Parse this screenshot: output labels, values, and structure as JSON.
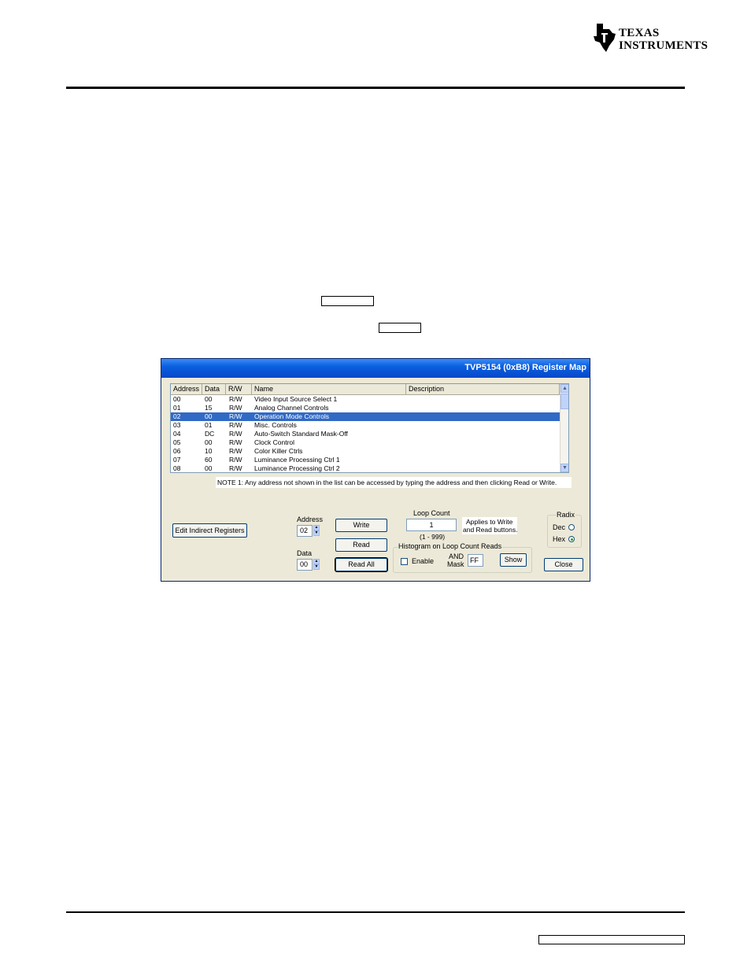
{
  "logo": {
    "line1": "Texas",
    "line2": "Instruments"
  },
  "dialog": {
    "title": "TVP5154 (0xB8) Register Map",
    "columns": [
      "Address",
      "Data",
      "R/W",
      "Name",
      "Description"
    ],
    "rows": [
      {
        "address": "00",
        "data": "00",
        "rw": "R/W",
        "name": "Video Input Source Select 1"
      },
      {
        "address": "01",
        "data": "15",
        "rw": "R/W",
        "name": "Analog Channel Controls"
      },
      {
        "address": "02",
        "data": "00",
        "rw": "R/W",
        "name": "Operation Mode Controls"
      },
      {
        "address": "03",
        "data": "01",
        "rw": "R/W",
        "name": "Misc. Controls"
      },
      {
        "address": "04",
        "data": "DC",
        "rw": "R/W",
        "name": "Auto-Switch Standard Mask-Off"
      },
      {
        "address": "05",
        "data": "00",
        "rw": "R/W",
        "name": "Clock Control"
      },
      {
        "address": "06",
        "data": "10",
        "rw": "R/W",
        "name": "Color Killer Ctrls"
      },
      {
        "address": "07",
        "data": "60",
        "rw": "R/W",
        "name": "Luminance Processing Ctrl 1"
      },
      {
        "address": "08",
        "data": "00",
        "rw": "R/W",
        "name": "Luminance Processing Ctrl 2"
      }
    ],
    "note": "NOTE 1: Any address not shown in the list can be accessed by typing the address and then clicking Read or Write.",
    "edit_indirect_label": "Edit Indirect Registers",
    "address_label": "Address",
    "address_value": "02",
    "data_label": "Data",
    "data_value": "00",
    "write_label": "Write",
    "read_label": "Read",
    "read_all_label": "Read All",
    "loop_count_label": "Loop Count",
    "loop_count_value": "1",
    "loop_range": "(1 - 999)",
    "applies_line1": "Applies to Write",
    "applies_line2": "and Read buttons.",
    "histogram_label": "Histogram on Loop Count Reads",
    "enable_label": "Enable",
    "and_label": "AND",
    "mask_label": "Mask",
    "mask_value": "FF",
    "show_label": "Show",
    "radix_label": "Radix",
    "dec_label": "Dec",
    "hex_label": "Hex",
    "radix_selected": "Hex",
    "close_label": "Close",
    "selected_row": 2
  },
  "colors": {
    "titlebar": "#0a5fe0",
    "selection": "#316ac5",
    "dialog_bg": "#ece9d8"
  }
}
